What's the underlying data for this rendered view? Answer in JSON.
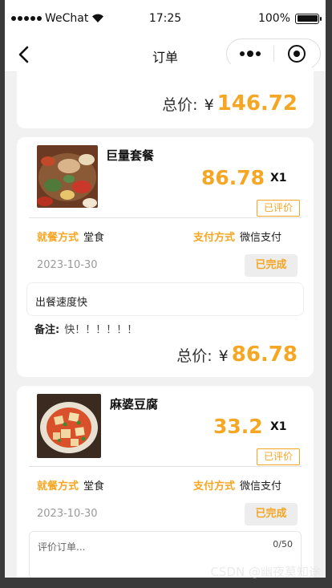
{
  "status_bar": {
    "carrier": "WeChat",
    "time": "17:25",
    "battery": "100%"
  },
  "nav": {
    "title": "订单"
  },
  "currency": "¥",
  "labels": {
    "total": "总价:",
    "dine_method": "就餐方式",
    "pay_method": "支付方式",
    "remark": "备注:",
    "rated": "已评价"
  },
  "top_card": {
    "total": "146.72"
  },
  "orders": [
    {
      "name": "巨量套餐",
      "price": "86.78",
      "qty": "X1",
      "dine": "堂食",
      "pay": "微信支付",
      "date": "2023-10-30",
      "status": "已完成",
      "comment": "出餐速度快",
      "remark": "快！！！！！！",
      "total": "86.78"
    },
    {
      "name": "麻婆豆腐",
      "price": "33.2",
      "qty": "X1",
      "dine": "堂食",
      "pay": "微信支付",
      "date": "2023-10-30",
      "status": "已完成",
      "review_placeholder": "评价订单...",
      "review_counter": "0/50"
    }
  ],
  "watermark": "CSDN @幽夜莫知途",
  "colors": {
    "accent": "#f5a623",
    "bg": "#f1f1f1"
  }
}
